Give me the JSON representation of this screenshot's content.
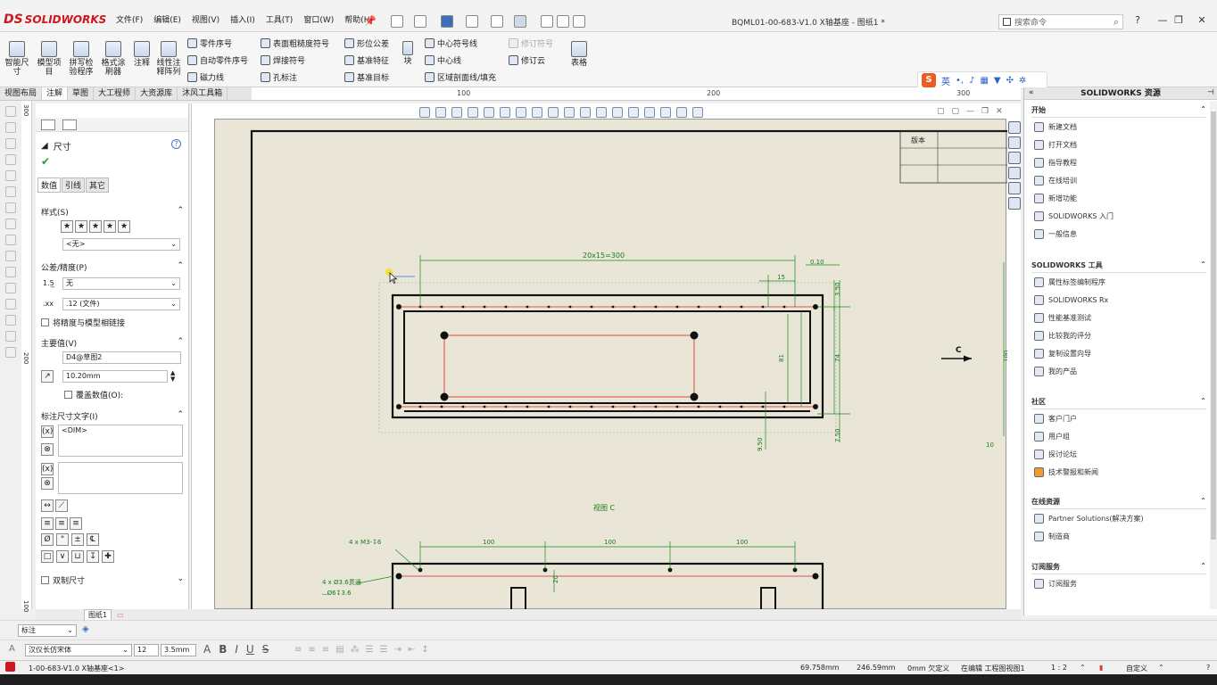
{
  "app": {
    "brand": "SOLIDWORKS",
    "document_title": "BQML01-00-683-V1.0 X轴基座 - 图纸1 *"
  },
  "menu": [
    "文件(F)",
    "编辑(E)",
    "视图(V)",
    "插入(I)",
    "工具(T)",
    "窗口(W)",
    "帮助(H)"
  ],
  "search": {
    "placeholder": "搜索命令"
  },
  "ribbon": {
    "big": [
      "智能尺寸",
      "模型项目",
      "拼写检验程序",
      "格式涂刷器",
      "注释",
      "线性注释阵列",
      "块",
      "表格"
    ],
    "small": {
      "col1": [
        "零件序号",
        "自动零件序号",
        "磁力线"
      ],
      "col2": [
        "表面粗糙度符号",
        "焊接符号",
        "孔标注"
      ],
      "col3": [
        "形位公差",
        "基准特征",
        "基准目标"
      ],
      "col4": [
        "中心符号线",
        "中心线",
        "区域剖面线/填充"
      ],
      "col5": [
        "修订符号",
        "修订云"
      ]
    },
    "ime_label": "英"
  },
  "tabs": [
    "视图布局",
    "注解",
    "草图",
    "大工程师",
    "大资源库",
    "沐风工具箱"
  ],
  "active_tab": "注解",
  "ruler": {
    "marks": [
      "100",
      "200",
      "300"
    ]
  },
  "vruler": {
    "marks": [
      "300",
      "200",
      "100"
    ]
  },
  "property_manager": {
    "title": "尺寸",
    "tabs": [
      "数值",
      "引线",
      "其它"
    ],
    "style_label": "样式(S)",
    "style_value": "<无>",
    "tolerance_label": "公差/精度(P)",
    "tolerance_value": "无",
    "precision_value": ".12 (文件)",
    "link_precision": "将精度与模型相链接",
    "primary_label": "主要值(V)",
    "primary_name": "D4@草图2",
    "primary_value": "10.20mm",
    "override": "覆盖数值(O):",
    "dimtext_label": "标注尺寸文字(I)",
    "dimtext_value": "<DIM>",
    "dual_label": "双制尺寸"
  },
  "drawing": {
    "top_dim": "20x15=300",
    "dim_15": "15",
    "dim_010": "0.10",
    "dim_350": "3.50",
    "dim_81": "81",
    "dim_74": "74",
    "dim_100v": "100",
    "dim_10": "10",
    "dim_950": "9.50",
    "dim_750": "7.50",
    "view_label": "视图 C",
    "arrow_label": "C",
    "hole_note1": "4 x M3-↧6",
    "hole_note2": "4 x Ø3.6贯通",
    "hole_note3": "⌴Ø6↧3.6",
    "bottom_dims": [
      "100",
      "100",
      "100"
    ],
    "small_dim": "20",
    "title_block": "版本"
  },
  "right_panel": {
    "title": "SOLIDWORKS 资源",
    "sections": [
      {
        "title": "开始",
        "items": [
          "新建文档",
          "打开文档",
          "指导教程",
          "在线培训",
          "新增功能",
          "SOLIDWORKS 入门",
          "一般信息"
        ]
      },
      {
        "title": "SOLIDWORKS 工具",
        "items": [
          "属性标签编制程序",
          "SOLIDWORKS Rx",
          "性能基准测试",
          "比较我的评分",
          "复制设置向导",
          "我的产品"
        ]
      },
      {
        "title": "社区",
        "items": [
          "客户门户",
          "用户组",
          "探讨论坛",
          "技术警报和新闻"
        ]
      },
      {
        "title": "在线资源",
        "items": [
          "Partner Solutions(解决方案)",
          "制造商"
        ]
      },
      {
        "title": "订阅服务",
        "items": [
          "订阅服务"
        ]
      }
    ]
  },
  "sheet_tab": "图纸1",
  "layer": {
    "value": "标注"
  },
  "format": {
    "font": "汉仪长仿宋体",
    "size": "12",
    "height": "3.5mm"
  },
  "status": {
    "doc": "1-00-683-V1.0 X轴基座<1>",
    "x": "69.758mm",
    "y": "246.59mm",
    "z": "0mm 欠定义",
    "mode": "在编辑 工程图视图1",
    "scale": "1 : 2",
    "units": "自定义"
  }
}
